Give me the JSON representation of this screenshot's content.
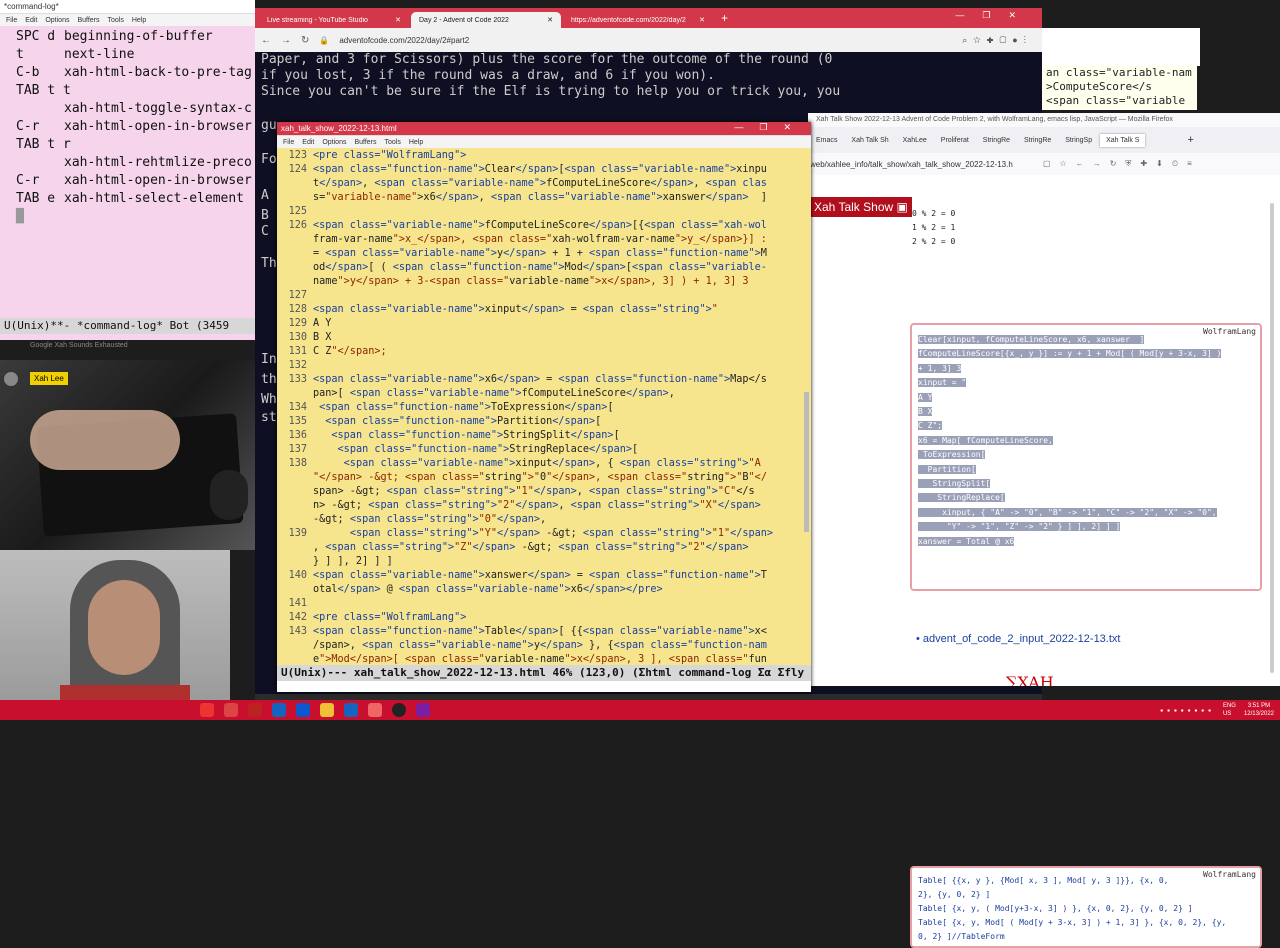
{
  "left_emacs": {
    "title": "*command-log*",
    "menu": [
      "File",
      "Edit",
      "Options",
      "Buffers",
      "Tools",
      "Help"
    ],
    "lines": [
      {
        "key": "SPC d",
        "cmd": "beginning-of-buffer"
      },
      {
        "key": "t",
        "cmd": "next-line"
      },
      {
        "key": "C-b",
        "cmd": "xah-html-back-to-pre-tag"
      },
      {
        "key": "TAB t t",
        "cmd": ""
      },
      {
        "key": "",
        "cmd": "xah-html-toggle-syntax-c"
      },
      {
        "key": "C-r",
        "cmd": "xah-html-open-in-browser"
      },
      {
        "key": "TAB t r",
        "cmd": ""
      },
      {
        "key": "",
        "cmd": "xah-html-rehtmlize-preco"
      },
      {
        "key": "C-r",
        "cmd": "xah-html-open-in-browser"
      },
      {
        "key": "TAB e",
        "cmd": "xah-html-select-element"
      }
    ],
    "modeline": "U(Unix)**- *command-log* Bot (3459",
    "status_text": "Google Xah Sounds Exhausted"
  },
  "webcam": {
    "name_tag": "Xah Lee"
  },
  "chrome": {
    "tabs": [
      "Live streaming - YouTube Studio",
      "Day 2 - Advent of Code 2022",
      "https://adventofcode.com/2022/day/2"
    ],
    "url": "adventofcode.com/2022/day/2#part2",
    "page_lines": [
      "Paper, and 3 for Scissors) plus the score for the outcome of the round (0",
      "if you lost, 3 if the round was a draw, and 6 if you won).",
      "",
      "Since you can't be sure if the Elf is trying to help you or trick you, you"
    ],
    "left_fragments": [
      "gu",
      "Fo",
      "A",
      "B",
      "C",
      "Th",
      "In",
      "th",
      "Wh",
      "st"
    ]
  },
  "right_code_fragments": [
    "an class=\"variable-nam",
    ">ComputeScore</s",
    "<span class=\"variable"
  ],
  "emacs_main": {
    "title": "xah_talk_show_2022-12-13.html",
    "menu": [
      "File",
      "Edit",
      "Options",
      "Buffers",
      "Tools",
      "Help"
    ],
    "lines": [
      {
        "n": "123",
        "t": "<pre class=\"WolframLang\">"
      },
      {
        "n": "124",
        "t": "<span class=\"function-name\">Clear</span>[<span class=\"variable-name\">xinpu"
      },
      {
        "n": "",
        "t": "t</span>, <span class=\"variable-name\">fComputeLineScore</span>, <span clas"
      },
      {
        "n": "",
        "t": "s=\"variable-name\">x6</span>, <span class=\"variable-name\">xanswer</span>  ]"
      },
      {
        "n": "125",
        "t": ""
      },
      {
        "n": "126",
        "t": "<span class=\"variable-name\">fComputeLineScore</span>[{<span class=\"xah-wol"
      },
      {
        "n": "",
        "t": "fram-var-name\">x_</span>, <span class=\"xah-wolfram-var-name\">y_</span>}] :"
      },
      {
        "n": "",
        "t": "= <span class=\"variable-name\">y</span> + 1 + <span class=\"function-name\">M"
      },
      {
        "n": "",
        "t": "od</span>[ ( <span class=\"function-name\">Mod</span>[<span class=\"variable-"
      },
      {
        "n": "",
        "t": "name\">y</span> + 3-<span class=\"variable-name\">x</span>, 3] ) + 1, 3] 3"
      },
      {
        "n": "127",
        "t": ""
      },
      {
        "n": "128",
        "t": "<span class=\"variable-name\">xinput</span> = <span class=\"string\">\""
      },
      {
        "n": "129",
        "t": "A Y"
      },
      {
        "n": "130",
        "t": "B X"
      },
      {
        "n": "131",
        "t": "C Z\"</span>;"
      },
      {
        "n": "132",
        "t": ""
      },
      {
        "n": "133",
        "t": "<span class=\"variable-name\">x6</span> = <span class=\"function-name\">Map</s"
      },
      {
        "n": "",
        "t": "pan>[ <span class=\"variable-name\">fComputeLineScore</span>,"
      },
      {
        "n": "134",
        "t": " <span class=\"function-name\">ToExpression</span>["
      },
      {
        "n": "135",
        "t": "  <span class=\"function-name\">Partition</span>["
      },
      {
        "n": "136",
        "t": "   <span class=\"function-name\">StringSplit</span>["
      },
      {
        "n": "137",
        "t": "    <span class=\"function-name\">StringReplace</span>["
      },
      {
        "n": "138",
        "t": "     <span class=\"variable-name\">xinput</span>, { <span class=\"string\">\"A"
      },
      {
        "n": "",
        "t": "\"</span> -&gt; <span class=\"string\">\"0\"</span>, <span class=\"string\">\"B\"</"
      },
      {
        "n": "",
        "t": "span> -&gt; <span class=\"string\">\"1\"</span>, <span class=\"string\">\"C\"</s"
      },
      {
        "n": "",
        "t": "n> -&gt; <span class=\"string\">\"2\"</span>, <span class=\"string\">\"X\"</span>"
      },
      {
        "n": "",
        "t": "-&gt; <span class=\"string\">\"0\"</span>,"
      },
      {
        "n": "139",
        "t": "      <span class=\"string\">\"Y\"</span> -&gt; <span class=\"string\">\"1\"</span>"
      },
      {
        "n": "",
        "t": ", <span class=\"string\">\"Z\"</span> -&gt; <span class=\"string\">\"2\"</span>"
      },
      {
        "n": "",
        "t": "} ] ], 2] ] ]"
      },
      {
        "n": "140",
        "t": "<span class=\"variable-name\">xanswer</span> = <span class=\"function-name\">T"
      },
      {
        "n": "",
        "t": "otal</span> @ <span class=\"variable-name\">x6</span></pre>"
      },
      {
        "n": "141",
        "t": ""
      },
      {
        "n": "142",
        "t": "<pre class=\"WolframLang\">"
      },
      {
        "n": "143",
        "t": "<span class=\"function-name\">Table</span>[ {{<span class=\"variable-name\">x<"
      },
      {
        "n": "",
        "t": "/span>, <span class=\"variable-name\">y</span> }, {<span class=\"function-nam"
      },
      {
        "n": "",
        "t": "e\">Mod</span>[ <span class=\"variable-name\">x</span>, 3 ], <span class=\"fun"
      }
    ],
    "modeline": "U(Unix)--- xah_talk_show_2022-12-13.html 46% (123,0) (Σhtml command-log Σα Σfly"
  },
  "firefox": {
    "title": "Xah Talk Show 2022-12-13 Advent of Code Problem 2, with WolframLang, emacs lisp, JavaScript — Mozilla Firefox",
    "tabs": [
      "Emacs",
      "Xah Talk Sh",
      "XahLee",
      "Proliferat",
      "StringRe",
      "StringRe",
      "StringSp",
      "Xah Talk S"
    ],
    "url": "web/xahlee_info/talk_show/xah_talk_show_2022-12-13.h",
    "banner": "Xah Talk Show",
    "mod_lines": [
      "0 % 2 = 0",
      "1 % 2 = 1",
      "2 % 2 = 0"
    ],
    "block1": {
      "badge": "WolframLang",
      "lines": [
        "Clear[xinput, fComputeLineScore, x6, xanswer  ]",
        "",
        "fComputeLineScore[{x_, y_}] := y + 1 + Mod[ ( Mod[y + 3-x, 3] )",
        "+ 1, 3] 3",
        "",
        "xinput = \"",
        "A Y",
        "B X",
        "C Z\";",
        "",
        "x6 = Map[ fComputeLineScore,",
        " ToExpression[",
        "  Partition[",
        "   StringSplit[",
        "    StringReplace[",
        "     xinput, { \"A\" -> \"0\", \"B\" -> \"1\", \"C\" -> \"2\", \"X\" -> \"0\",",
        "      \"Y\" -> \"1\", \"Z\" -> \"2\" } ] ], 2] ] ]",
        "xanswer = Total @ x6"
      ]
    },
    "block2": {
      "badge": "WolframLang",
      "lines": [
        "Table[ {{x, y }, {Mod[ x, 3 ], Mod[ y, 3 ]}}, {x, 0,",
        "2}, {y, 0, 2} ]",
        "Table[ {x, y, ( Mod[y+3-x, 3] ) }, {x, 0, 2}, {y, 0, 2} ]",
        "Table[ {x, y, Mod[ ( Mod[y + 3-x, 3] ) + 1, 3] }, {x, 0, 2}, {y,",
        "0, 2} ]//TableForm"
      ]
    },
    "link": "advent_of_code_2_input_2022-12-13.txt",
    "logo_text": "∑XAH"
  },
  "taskbar": {
    "time": "3:51 PM",
    "date": "12/13/2022",
    "lang": "ENG",
    "region": "US"
  },
  "colors": {
    "yellow": "#f6e58d",
    "chrome_red": "#d2384a",
    "taskbar_red": "#c8102e",
    "code_fn": "#1a3fa0",
    "code_var": "#7a0a8a",
    "code_str": "#8b2500"
  }
}
